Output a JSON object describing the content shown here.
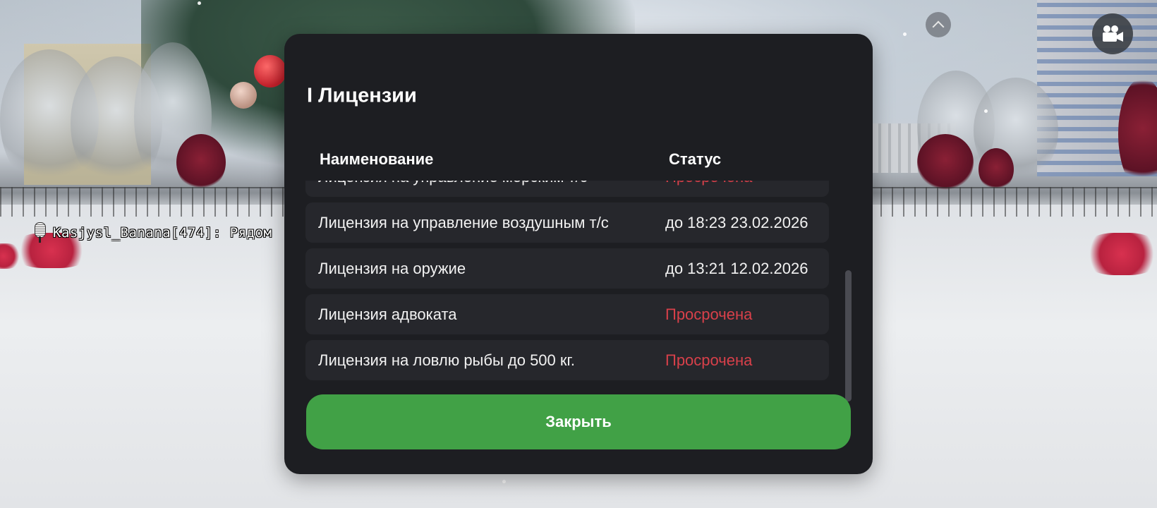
{
  "hud": {
    "player_tag": "Kasjysl_Banana[474]: Рядом",
    "up_icon": "chevron-up-icon",
    "camera_icon": "video-camera-icon"
  },
  "modal": {
    "title": "I Лицензии",
    "columns": {
      "name": "Наименование",
      "status": "Статус"
    },
    "rows": [
      {
        "name": "Лицензия на управление морским т/с",
        "status": "Просрочена",
        "expired": true
      },
      {
        "name": "Лицензия на управление воздушным т/с",
        "status": "до 18:23 23.02.2026",
        "expired": false
      },
      {
        "name": "Лицензия на оружие",
        "status": "до 13:21 12.02.2026",
        "expired": false
      },
      {
        "name": "Лицензия адвоката",
        "status": "Просрочена",
        "expired": true
      },
      {
        "name": "Лицензия на ловлю рыбы до 500 кг.",
        "status": "Просрочена",
        "expired": true
      }
    ],
    "close_label": "Закрыть"
  },
  "colors": {
    "expired": "#d8404a",
    "valid": "#f2f2f2",
    "close_button": "#41a146",
    "panel": "#1d1e22",
    "row": "#26272c"
  }
}
